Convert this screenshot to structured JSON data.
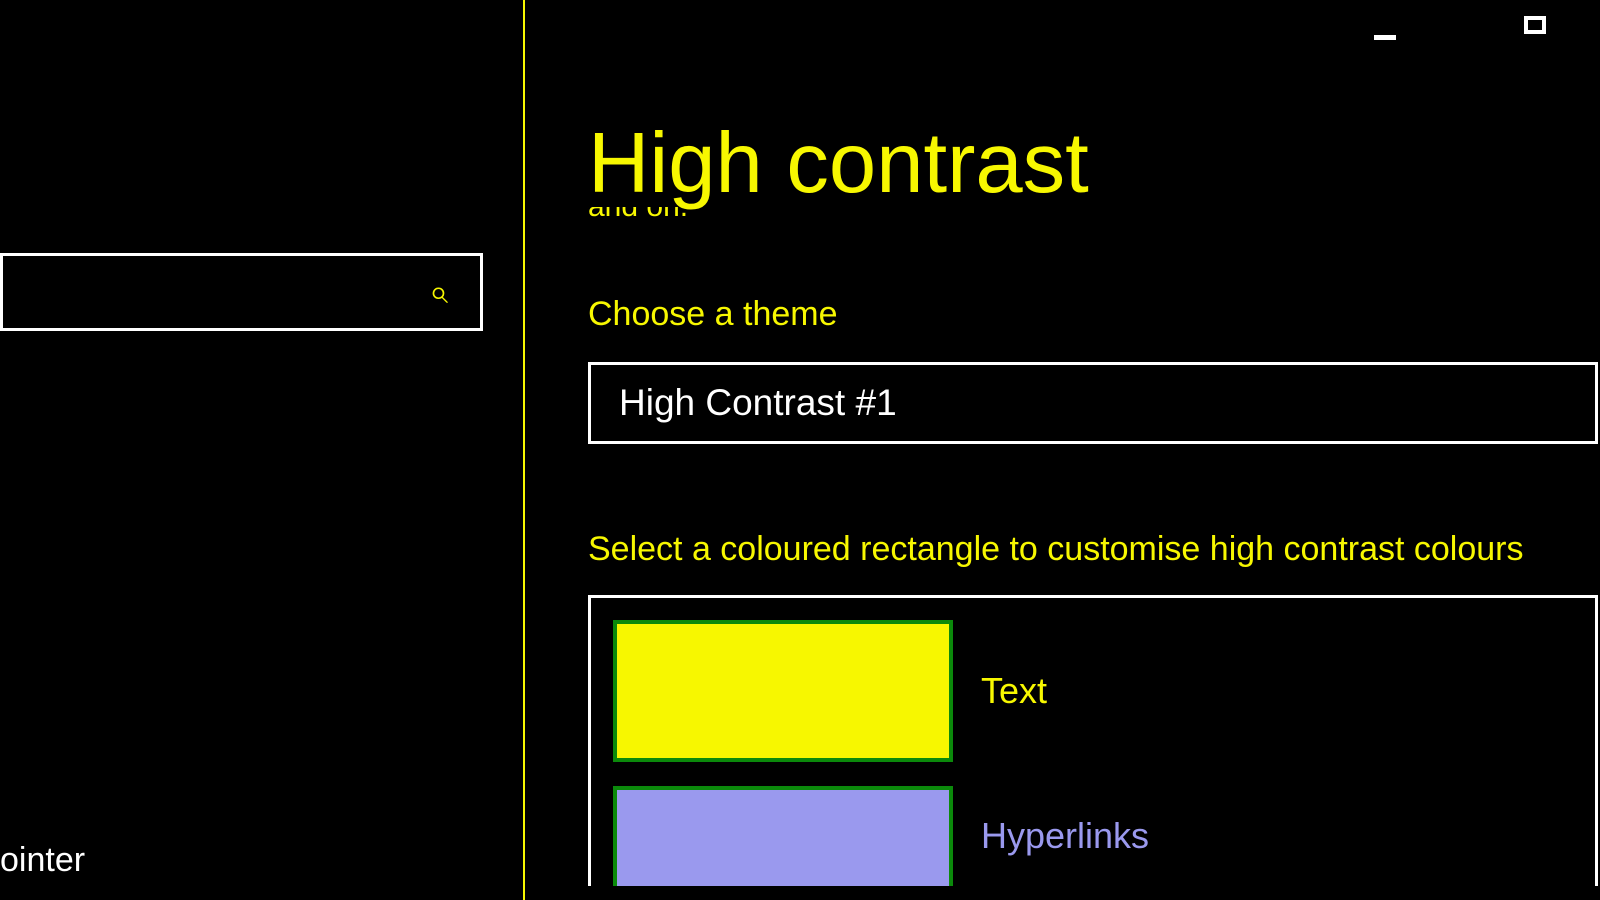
{
  "window": {
    "minimize": "Minimize",
    "maximize": "Maximize"
  },
  "sidebar": {
    "search_placeholder": "",
    "nav_item_partial": "ointer"
  },
  "main": {
    "title": "High contrast",
    "cut_fragment": "and on.",
    "choose_theme_label": "Choose a theme",
    "theme_selected": "High Contrast #1",
    "customise_label": "Select a coloured rectangle to customise high contrast colours",
    "swatches": {
      "text": {
        "label": "Text",
        "color": "#f7f700"
      },
      "hyperlinks": {
        "label": "Hyperlinks",
        "color": "#9a99ee"
      }
    }
  }
}
